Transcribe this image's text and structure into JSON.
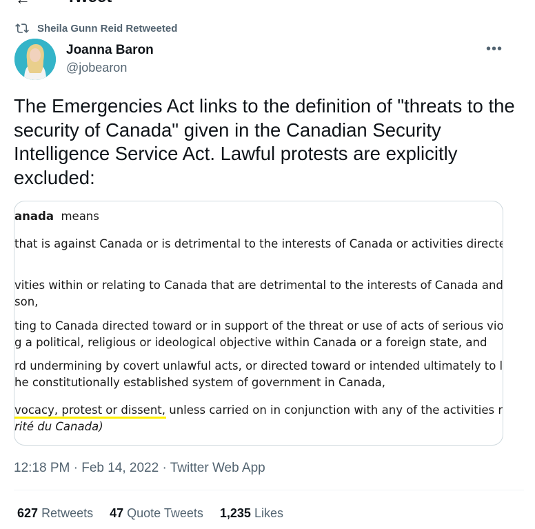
{
  "header": {
    "title": "Tweet"
  },
  "retweet": {
    "label": "Sheila Gunn Reid Retweeted"
  },
  "author": {
    "name": "Joanna Baron",
    "handle": "@jobearon"
  },
  "tweet": {
    "text": "The Emergencies Act links to the definition of \"threats to the security of Canada\" given in the Canadian Security Intelligence Service Act. Lawful protests are explicitly excluded:"
  },
  "media": {
    "lines": [
      "anada",
      "means",
      "that is against Canada or is detrimental to the interests of Canada or activities directed",
      "vities within or relating to Canada that are detrimental to the interests of Canada and ar",
      "son,",
      "ting to Canada directed toward or in support of the threat or use of acts of serious violer",
      "g a political, religious or ideological objective within Canada or a foreign state, and",
      "rd undermining by covert unlawful acts, or directed toward or intended ultimately to lea",
      "he constitutionally established system of government in Canada,",
      "vocacy, protest or dissent,",
      "unless carried on in conjunction with any of the activities refe",
      "rité du Canada)"
    ]
  },
  "meta": {
    "time": "12:18 PM · Feb 14, 2022 · Twitter Web App"
  },
  "stats": {
    "retweets_count": "627",
    "retweets_label": "Retweets",
    "quotes_count": "47",
    "quotes_label": "Quote Tweets",
    "likes_count": "1,235",
    "likes_label": "Likes"
  },
  "colors": {
    "accent": "#ffef00",
    "muted": "#536471",
    "text": "#0f1419",
    "avatar_bg": "#34b4c8"
  },
  "icons": {
    "retweet": "retweet-icon",
    "more": "more-icon",
    "back": "back-arrow-icon"
  }
}
